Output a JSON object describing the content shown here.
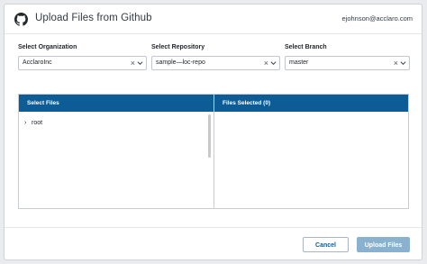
{
  "dialog": {
    "title": "Upload Files from Github",
    "user_email": "ejohnson@acclaro.com"
  },
  "fields": {
    "organization": {
      "label": "Select Organization",
      "value": "AcclaroInc"
    },
    "repository": {
      "label": "Select Repository",
      "value": "sample—loc-repo"
    },
    "branch": {
      "label": "Select Branch",
      "value": "master"
    },
    "clear_glyph": "×"
  },
  "panels": {
    "select_files_header": "Select Files",
    "files_selected_header": "Files Selected (0)",
    "tree": [
      {
        "label": "root",
        "arrow": "›"
      }
    ]
  },
  "footer": {
    "cancel_label": "Cancel",
    "upload_label": "Upload Files"
  },
  "colors": {
    "header_blue": "#0d5c96",
    "upload_disabled": "#8ab2cf",
    "cancel_text": "#0d5c96"
  },
  "icons": {
    "title": "github-icon",
    "select": "chevron-down-icon",
    "clear": "clear-icon",
    "tree": "chevron-right-icon"
  }
}
